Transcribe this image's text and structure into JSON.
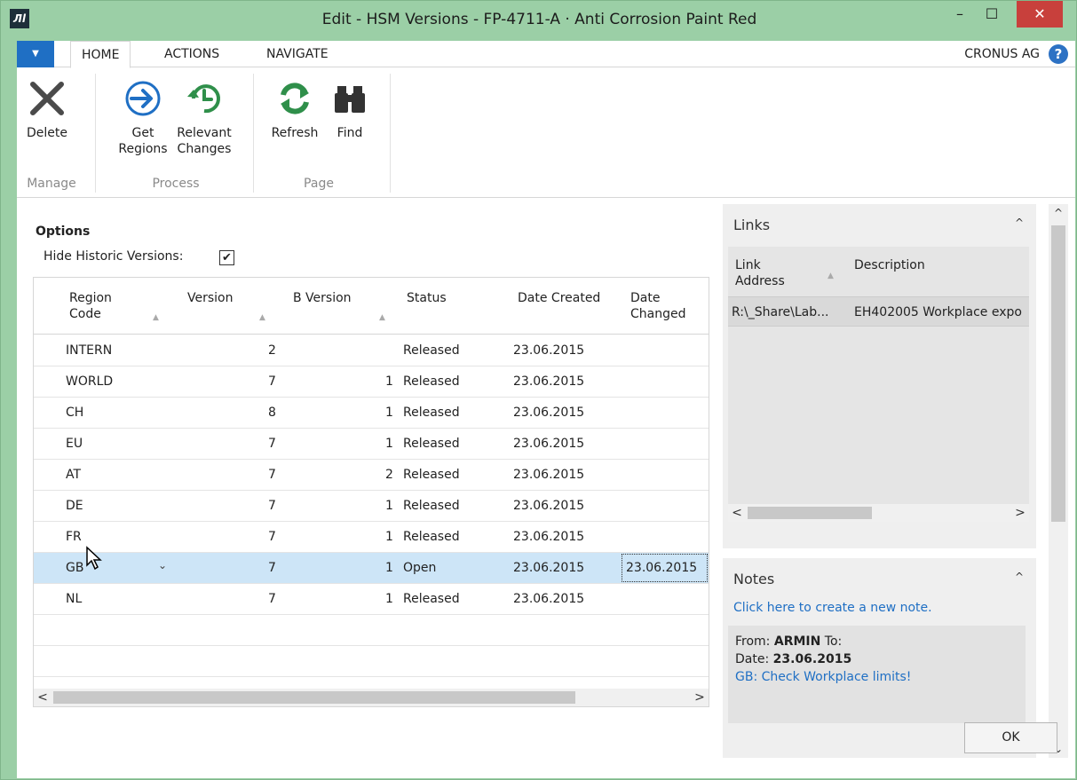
{
  "window": {
    "title": "Edit - HSM Versions - FP-4711-A · Anti Corrosion Paint Red",
    "logo_text": "Лl",
    "min_glyph": "–",
    "max_glyph": "☐",
    "close_glyph": "✕"
  },
  "tabs": {
    "menu_glyph": "▼",
    "items": [
      "HOME",
      "ACTIONS",
      "NAVIGATE"
    ],
    "company": "CRONUS AG",
    "help_glyph": "?"
  },
  "ribbon": {
    "delete": "Delete",
    "get_regions": "Get\nRegions",
    "relevant_changes": "Relevant\nChanges",
    "refresh": "Refresh",
    "find": "Find",
    "groups": [
      "Manage",
      "Process",
      "Page"
    ]
  },
  "options": {
    "title": "Options",
    "hide_label": "Hide Historic Versions:",
    "hide_checked": "✔"
  },
  "grid": {
    "headers": {
      "region_code": "Region\nCode",
      "version": "Version",
      "b_version": "B Version",
      "status": "Status",
      "date_created": "Date Created",
      "date_changed": "Date\nChanged"
    },
    "sort_glyph": "▲",
    "rows": [
      {
        "region": "INTERN",
        "version": "2",
        "b_version": "",
        "status": "Released",
        "date_created": "23.06.2015",
        "date_changed": ""
      },
      {
        "region": "WORLD",
        "version": "7",
        "b_version": "1",
        "status": "Released",
        "date_created": "23.06.2015",
        "date_changed": ""
      },
      {
        "region": "CH",
        "version": "8",
        "b_version": "1",
        "status": "Released",
        "date_created": "23.06.2015",
        "date_changed": ""
      },
      {
        "region": "EU",
        "version": "7",
        "b_version": "1",
        "status": "Released",
        "date_created": "23.06.2015",
        "date_changed": ""
      },
      {
        "region": "AT",
        "version": "7",
        "b_version": "2",
        "status": "Released",
        "date_created": "23.06.2015",
        "date_changed": ""
      },
      {
        "region": "DE",
        "version": "7",
        "b_version": "1",
        "status": "Released",
        "date_created": "23.06.2015",
        "date_changed": ""
      },
      {
        "region": "FR",
        "version": "7",
        "b_version": "1",
        "status": "Released",
        "date_created": "23.06.2015",
        "date_changed": ""
      },
      {
        "region": "GB",
        "version": "7",
        "b_version": "1",
        "status": "Open",
        "date_created": "23.06.2015",
        "date_changed": "23.06.2015"
      },
      {
        "region": "NL",
        "version": "7",
        "b_version": "1",
        "status": "Released",
        "date_created": "23.06.2015",
        "date_changed": ""
      }
    ],
    "dropdown_glyph": "⌄",
    "left_glyph": "<",
    "right_glyph": ">"
  },
  "links": {
    "title": "Links",
    "collapse_glyph": "^",
    "headers": {
      "link_address": "Link\nAddress",
      "description": "Description"
    },
    "sort_glyph": "▲",
    "row": {
      "address": "R:\\_Share\\Lab...",
      "description": "EH402005 Workplace expo"
    },
    "left_glyph": "<",
    "right_glyph": ">"
  },
  "notes": {
    "title": "Notes",
    "collapse_glyph": "^",
    "new_note": "Click here to create a new note.",
    "from_label": "From:",
    "from_value": "ARMIN",
    "to_label": "To:",
    "date_label": "Date:",
    "date_value": "23.06.2015",
    "message": "GB: Check Workplace limits!"
  },
  "vscroll": {
    "up_glyph": "^",
    "down_glyph": "⌄"
  },
  "footer": {
    "ok": "OK"
  },
  "colors": {
    "frame": "#9bcfa6",
    "accent_blue": "#1f6fc4",
    "selected_row": "#cde5f7",
    "close_red": "#c8403c"
  },
  "icons": [
    "app-logo-icon",
    "delete-x-icon",
    "get-regions-arrow-icon",
    "relevant-changes-history-icon",
    "refresh-icon",
    "binoculars-find-icon",
    "help-icon",
    "mouse-cursor-icon"
  ]
}
